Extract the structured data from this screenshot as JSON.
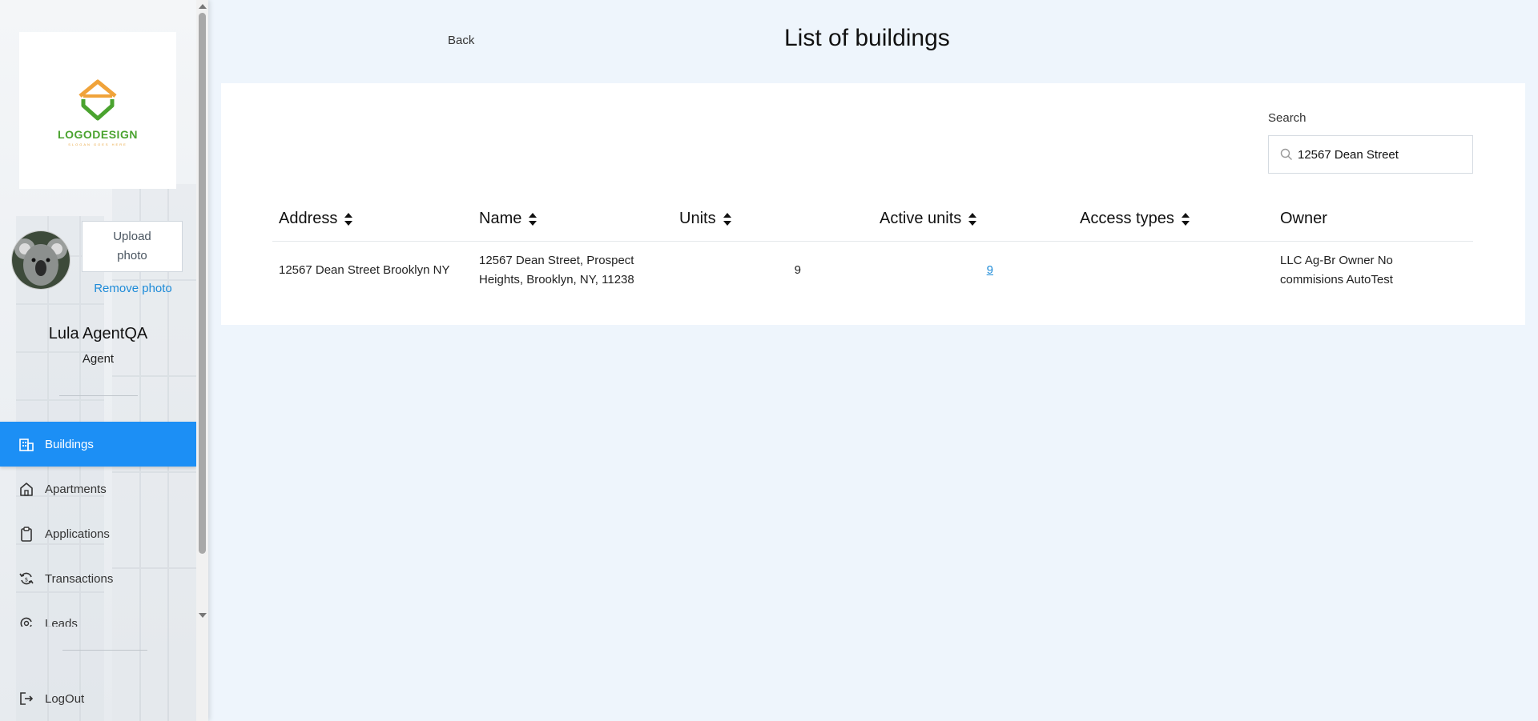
{
  "sidebar": {
    "logo": {
      "name": "LOGODESIGN",
      "slogan": "SLOGAN GOES HERE"
    },
    "upload_photo_label": "Upload photo",
    "remove_photo_label": "Remove photo",
    "user_name": "Lula AgentQA",
    "user_role": "Agent",
    "nav": [
      {
        "label": "Buildings",
        "icon": "building-icon",
        "active": true
      },
      {
        "label": "Apartments",
        "icon": "home-icon"
      },
      {
        "label": "Applications",
        "icon": "clipboard-icon"
      },
      {
        "label": "Transactions",
        "icon": "transactions-icon"
      },
      {
        "label": "Leads",
        "icon": "leads-icon"
      }
    ],
    "logout_label": "LogOut"
  },
  "header": {
    "back_label": "Back",
    "title": "List of buildings"
  },
  "search": {
    "label": "Search",
    "value": "12567 Dean Street"
  },
  "table": {
    "columns": [
      "Address",
      "Name",
      "Units",
      "Active units",
      "Access types",
      "Owner"
    ],
    "rows": [
      {
        "address": "12567 Dean Street Brooklyn NY",
        "name_line1": "12567 Dean Street, Prospect",
        "name_line2": "Heights, Brooklyn, NY, 11238",
        "units": "9",
        "active_units": "9",
        "access_types": "",
        "owner_line1": "LLC Ag-Br Owner No",
        "owner_line2": "commisions AutoTest"
      }
    ]
  },
  "colors": {
    "accent": "#1c8ff5",
    "link": "#1e8bd8",
    "background": "#eef5fc"
  }
}
